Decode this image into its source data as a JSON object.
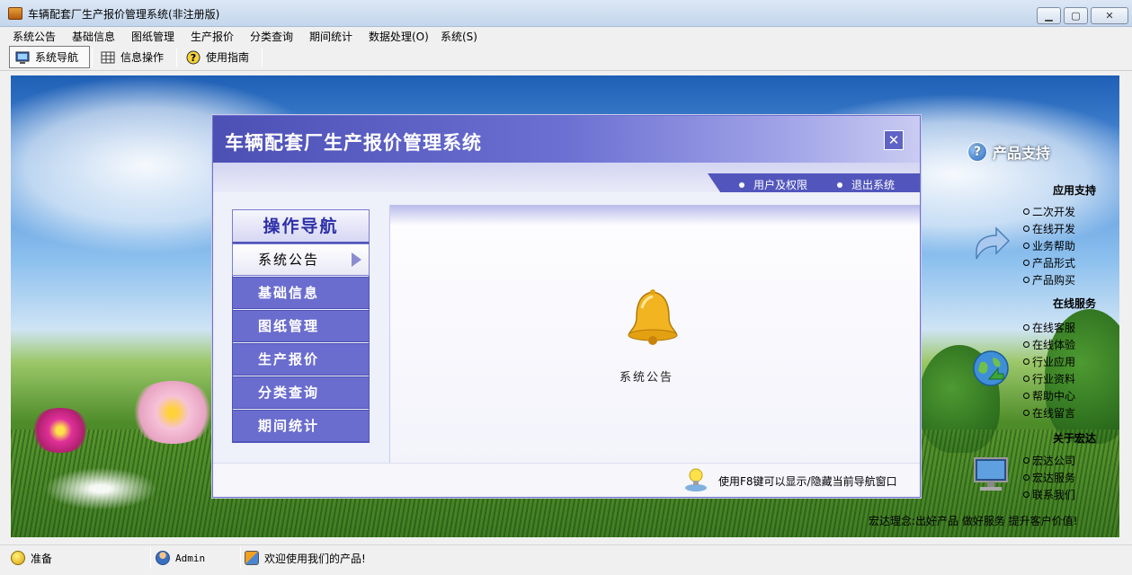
{
  "window": {
    "title": "车辆配套厂生产报价管理系统(非注册版)"
  },
  "menu": [
    "系统公告",
    "基础信息",
    "图纸管理",
    "生产报价",
    "分类查询",
    "期间统计",
    "数据处理(O)",
    "系统(S)"
  ],
  "toolbar": {
    "nav": "系统导航",
    "info": "信息操作",
    "guide": "使用指南"
  },
  "dialog": {
    "title": "车辆配套厂生产报价管理系统",
    "close": "✕",
    "links": {
      "users": "用户及权限",
      "exit": "退出系统"
    },
    "nav_title": "操作导航",
    "nav_items": [
      "系统公告",
      "基础信息",
      "图纸管理",
      "生产报价",
      "分类查询",
      "期间统计"
    ],
    "content_label": "系统公告",
    "footer": "使用F8键可以显示/隐藏当前导航窗口"
  },
  "sidebar": {
    "header": "产品支持",
    "sections": [
      {
        "title": "应用支持",
        "links": [
          "二次开发",
          "在线开发",
          "业务帮助",
          "产品形式",
          "产品购买"
        ]
      },
      {
        "title": "在线服务",
        "links": [
          "在线客服",
          "在线体验",
          "行业应用",
          "行业资料",
          "帮助中心",
          "在线留言"
        ]
      },
      {
        "title": "关于宏达",
        "links": [
          "宏达公司",
          "宏达服务",
          "联系我们"
        ]
      }
    ],
    "slogan": "宏达理念:出好产品  做好服务  提升客户价值!"
  },
  "status": {
    "state": "准备",
    "user": "Admin",
    "welcome": "欢迎使用我们的产品!"
  },
  "colors": {
    "dialog_accent": "#5256bc",
    "nav_item_bg": "#6a6dce"
  }
}
